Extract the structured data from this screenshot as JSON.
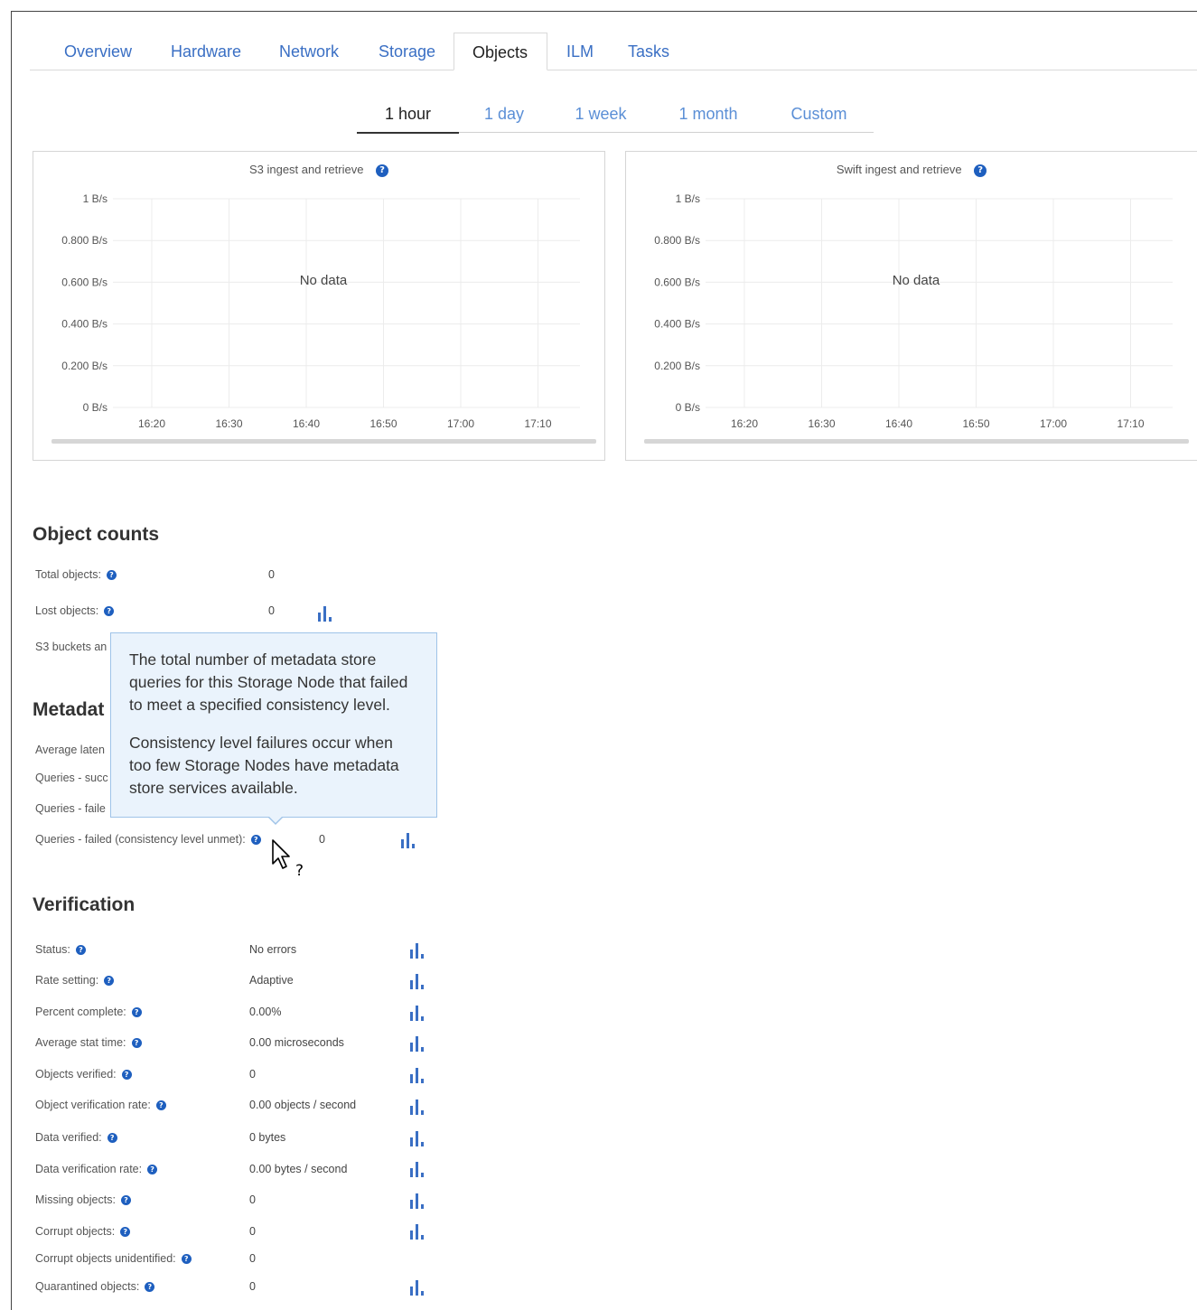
{
  "main_tabs": [
    {
      "label": "Overview",
      "active": false
    },
    {
      "label": "Hardware",
      "active": false
    },
    {
      "label": "Network",
      "active": false
    },
    {
      "label": "Storage",
      "active": false
    },
    {
      "label": "Objects",
      "active": true
    },
    {
      "label": "ILM",
      "active": false
    },
    {
      "label": "Tasks",
      "active": false
    }
  ],
  "time_tabs": [
    {
      "label": "1 hour",
      "active": true
    },
    {
      "label": "1 day",
      "active": false
    },
    {
      "label": "1 week",
      "active": false
    },
    {
      "label": "1 month",
      "active": false
    },
    {
      "label": "Custom",
      "active": false
    }
  ],
  "chart_data": [
    {
      "type": "line",
      "title": "S3 ingest and retrieve",
      "y_ticks": [
        "1 B/s",
        "0.800 B/s",
        "0.600 B/s",
        "0.400 B/s",
        "0.200 B/s",
        "0 B/s"
      ],
      "x_ticks": [
        "16:20",
        "16:30",
        "16:40",
        "16:50",
        "17:00",
        "17:10"
      ],
      "ylim": [
        0,
        1
      ],
      "series": [],
      "empty_message": "No data",
      "grid": true
    },
    {
      "type": "line",
      "title": "Swift ingest and retrieve",
      "y_ticks": [
        "1 B/s",
        "0.800 B/s",
        "0.600 B/s",
        "0.400 B/s",
        "0.200 B/s",
        "0 B/s"
      ],
      "x_ticks": [
        "16:20",
        "16:30",
        "16:40",
        "16:50",
        "17:00",
        "17:10"
      ],
      "ylim": [
        0,
        1
      ],
      "series": [],
      "empty_message": "No data",
      "grid": true
    }
  ],
  "object_counts": {
    "heading": "Object counts",
    "rows": [
      {
        "label": "Total objects:",
        "value": "0"
      },
      {
        "label": "Lost objects:",
        "value": "0"
      },
      {
        "label": "S3 buckets an",
        "value": ""
      }
    ]
  },
  "metadata": {
    "heading": "Metadat",
    "rows": [
      {
        "label": "Average laten"
      },
      {
        "label": "Queries - succ"
      },
      {
        "label": "Queries - faile"
      },
      {
        "label": "Queries - failed (consistency level unmet):",
        "value": "0"
      }
    ]
  },
  "tooltip": {
    "paragraph1": "The total number of metadata store queries for this Storage Node that failed to meet a specified consistency level.",
    "paragraph2": "Consistency level failures occur when too few Storage Nodes have metadata store services available."
  },
  "verification": {
    "heading": "Verification",
    "rows": [
      {
        "label": "Status:",
        "value": "No errors"
      },
      {
        "label": "Rate setting:",
        "value": "Adaptive"
      },
      {
        "label": "Percent complete:",
        "value": "0.00%"
      },
      {
        "label": "Average stat time:",
        "value": "0.00 microseconds"
      },
      {
        "label": "Objects verified:",
        "value": "0"
      },
      {
        "label": "Object verification rate:",
        "value": "0.00 objects / second"
      },
      {
        "label": "Data verified:",
        "value": "0 bytes"
      },
      {
        "label": "Data verification rate:",
        "value": "0.00 bytes / second"
      },
      {
        "label": "Missing objects:",
        "value": "0"
      },
      {
        "label": "Corrupt objects:",
        "value": "0"
      },
      {
        "label": "Corrupt objects unidentified:",
        "value": "0"
      },
      {
        "label": "Quarantined objects:",
        "value": "0"
      }
    ]
  },
  "colors": {
    "link": "#3a6fc4",
    "help_icon": "#1e5fbf",
    "tooltip_bg": "#eaf3fc"
  },
  "icons": {
    "help": "question-circle-icon",
    "chart": "bar-chart-icon",
    "cursor": "help-cursor-icon"
  },
  "help_glyph": "?"
}
